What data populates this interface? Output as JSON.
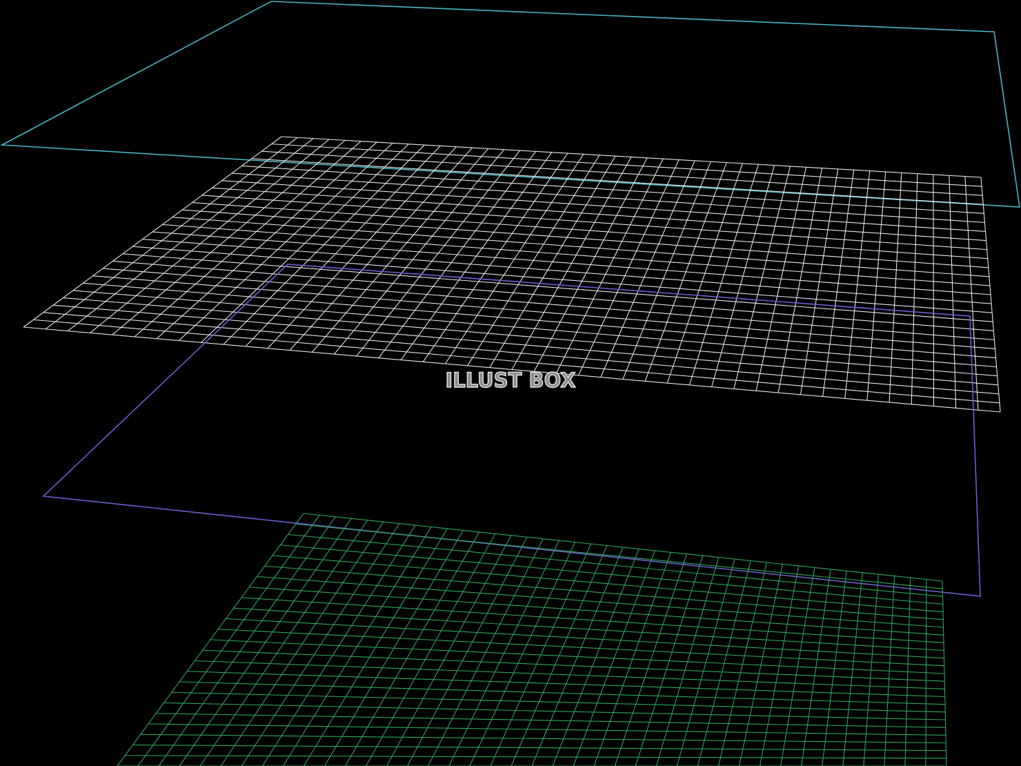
{
  "scene": {
    "background": "#000000",
    "planes": [
      {
        "name": "top-cyan-frame",
        "style": "outline",
        "color": "#46b9c8"
      },
      {
        "name": "white-grid-plane",
        "style": "grid",
        "color": "#e8e8e8",
        "columns": 44,
        "rows": 26
      },
      {
        "name": "purple-frame",
        "style": "outline",
        "color": "#6a5fd0"
      },
      {
        "name": "green-grid-plane",
        "style": "grid",
        "color": "#2fa85a",
        "columns": 40,
        "rows": 24
      }
    ]
  },
  "watermark": {
    "text": "ILLUST BOX"
  }
}
